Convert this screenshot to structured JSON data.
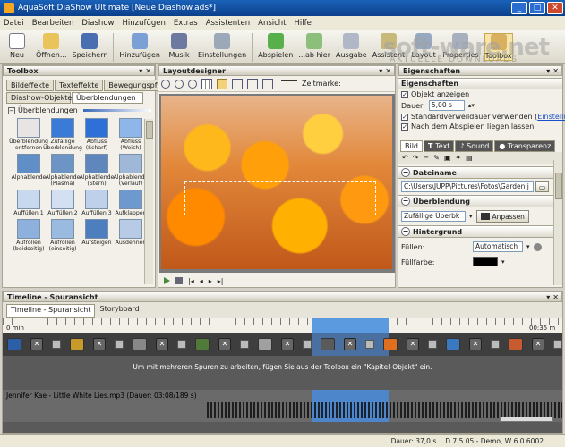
{
  "window": {
    "title": "AquaSoft DiaShow Ultimate [Neue Diashow.ads*]"
  },
  "menu": [
    "Datei",
    "Bearbeiten",
    "Diashow",
    "Hinzufügen",
    "Extras",
    "Assistenten",
    "Ansicht",
    "Hilfe"
  ],
  "toolbar": {
    "new": "Neu",
    "open": "Öffnen...",
    "save": "Speichern",
    "add": "Hinzufügen",
    "music": "Musik",
    "settings": "Einstellungen",
    "play": "Abspielen",
    "play_from_here": "...ab hier",
    "output": "Ausgabe",
    "wizard": "Assistent",
    "layout": "Layout",
    "properties": "Properties",
    "toolbox": "Toolbox"
  },
  "watermark": {
    "main": "soft-ware.net",
    "sub": "AKTUELLE DOWNLOADS"
  },
  "toolbox": {
    "title": "Toolbox",
    "tabs_row1": [
      "Bildeffekte",
      "Texteffekte",
      "Bewegungspfade"
    ],
    "tabs_row2": [
      "Diashow-Objekte",
      "Überblendungen"
    ],
    "group_label": "Überblendungen",
    "items": [
      {
        "label": "Überblendung entfernen",
        "color": "#e8e4e4"
      },
      {
        "label": "Zufällige Überblendung",
        "color": "#3b7bd8"
      },
      {
        "label": "Abfluss (Scharf)",
        "color": "#2f6fd8"
      },
      {
        "label": "Abfluss (Weich)",
        "color": "#8fb6e8"
      },
      {
        "label": "Alphablende",
        "color": "#5f8fc6"
      },
      {
        "label": "Alphablende (Plasma)",
        "color": "#6c94c4"
      },
      {
        "label": "Alphablende (Stern)",
        "color": "#5f87bd"
      },
      {
        "label": "Alphablende (Verlauf)",
        "color": "#9fb8d8"
      },
      {
        "label": "Auffüllen 1",
        "color": "#c8d8ee"
      },
      {
        "label": "Auffüllen 2",
        "color": "#d2e0f2"
      },
      {
        "label": "Auffüllen 3",
        "color": "#bed0ea"
      },
      {
        "label": "Aufklappen",
        "color": "#6d99cf"
      },
      {
        "label": "Aufrollen (beidseitig)",
        "color": "#8eb0dc"
      },
      {
        "label": "Aufrollen (einseitig)",
        "color": "#9bbae0"
      },
      {
        "label": "Aufsteigen",
        "color": "#4d7fbe"
      },
      {
        "label": "Ausdehnen",
        "color": "#b7cbe6"
      }
    ]
  },
  "layout": {
    "title": "Layoutdesigner",
    "marker_label": "Zeitmarke:"
  },
  "properties": {
    "title": "Eigenschaften",
    "section_title": "Eigenschaften",
    "show_object": "Objekt anzeigen",
    "duration_label": "Dauer:",
    "duration_value": "5,00 s",
    "use_default_duration": "Standardverweildauer verwenden (",
    "settings_link": "Einstellunge",
    "remain_after_play": "Nach dem Abspielen liegen lassen",
    "tabs": [
      "Bild",
      "Text",
      "Sound",
      "Transparenz"
    ],
    "file_section": "Dateiname",
    "file_path": "C:\\Users\\JUPP\\Pictures\\Fotos\\Garden.j",
    "transition_section": "Überblendung",
    "transition_value": "Zufällige Überbk",
    "adjust_button": "Anpassen",
    "background_section": "Hintergrund",
    "fill_label": "Füllen:",
    "fill_value": "Automatisch",
    "fill_color_label": "Füllfarbe:",
    "fill_color": "#000000"
  },
  "timeline": {
    "title": "Timeline - Spuransicht",
    "tabs": [
      "Timeline - Spuransicht",
      "Storyboard"
    ],
    "start_time": "0 min",
    "end_time": "00:35 m",
    "hint": "Um mit mehreren Spuren zu arbeiten, fügen Sie aus der Toolbox ein \"Kapitel-Objekt\" ein.",
    "audio_label": "Jennifer Kae - Little White Lies.mp3 (Dauer: 03:08/189 s)",
    "clip_colors": [
      "#2d5fa8",
      "#c89a2a",
      "#888888",
      "#4f7a3a",
      "#a0a0a0",
      "#5a5a5a",
      "#e07020",
      "#3a78c0",
      "#c85a30"
    ]
  },
  "status": {
    "duration": "Dauer: 37,0 s",
    "version": "D 7.5.05 - Demo, W 6.0.6002"
  },
  "colors": {
    "accent": "#316ac5",
    "selection": "#9ec0ec"
  }
}
